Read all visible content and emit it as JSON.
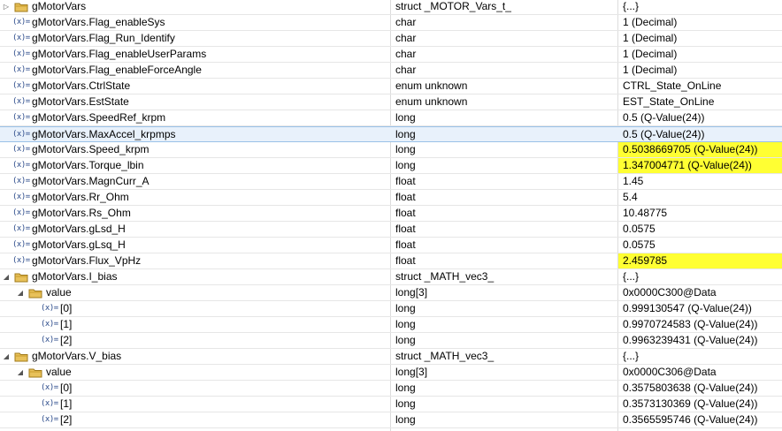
{
  "rows": [
    {
      "indent": 0,
      "expander": "collapsed",
      "icon": "folder",
      "name": "gMotorVars",
      "type": "struct _MOTOR_Vars_t_",
      "value": "{...}",
      "highlight": false
    },
    {
      "indent": 0,
      "expander": "none",
      "icon": "var",
      "name": "gMotorVars.Flag_enableSys",
      "type": "char",
      "value": "1 (Decimal)",
      "highlight": false
    },
    {
      "indent": 0,
      "expander": "none",
      "icon": "var",
      "name": "gMotorVars.Flag_Run_Identify",
      "type": "char",
      "value": "1 (Decimal)",
      "highlight": false
    },
    {
      "indent": 0,
      "expander": "none",
      "icon": "var",
      "name": "gMotorVars.Flag_enableUserParams",
      "type": "char",
      "value": "1 (Decimal)",
      "highlight": false
    },
    {
      "indent": 0,
      "expander": "none",
      "icon": "var",
      "name": "gMotorVars.Flag_enableForceAngle",
      "type": "char",
      "value": "1 (Decimal)",
      "highlight": false
    },
    {
      "indent": 0,
      "expander": "none",
      "icon": "var",
      "name": "gMotorVars.CtrlState",
      "type": "enum unknown",
      "value": "CTRL_State_OnLine",
      "highlight": false
    },
    {
      "indent": 0,
      "expander": "none",
      "icon": "var",
      "name": "gMotorVars.EstState",
      "type": "enum unknown",
      "value": "EST_State_OnLine",
      "highlight": false
    },
    {
      "indent": 0,
      "expander": "none",
      "icon": "var",
      "name": "gMotorVars.SpeedRef_krpm",
      "type": "long",
      "value": "0.5 (Q-Value(24))",
      "highlight": false
    },
    {
      "indent": 0,
      "expander": "none",
      "icon": "var",
      "name": "gMotorVars.MaxAccel_krpmps",
      "type": "long",
      "value": "0.5 (Q-Value(24))",
      "highlight": false,
      "selected": true
    },
    {
      "indent": 0,
      "expander": "none",
      "icon": "var",
      "name": "gMotorVars.Speed_krpm",
      "type": "long",
      "value": "0.5038669705 (Q-Value(24))",
      "highlight": true
    },
    {
      "indent": 0,
      "expander": "none",
      "icon": "var",
      "name": "gMotorVars.Torque_lbin",
      "type": "long",
      "value": "1.347004771 (Q-Value(24))",
      "highlight": true
    },
    {
      "indent": 0,
      "expander": "none",
      "icon": "var",
      "name": "gMotorVars.MagnCurr_A",
      "type": "float",
      "value": "1.45",
      "highlight": false
    },
    {
      "indent": 0,
      "expander": "none",
      "icon": "var",
      "name": "gMotorVars.Rr_Ohm",
      "type": "float",
      "value": "5.4",
      "highlight": false
    },
    {
      "indent": 0,
      "expander": "none",
      "icon": "var",
      "name": "gMotorVars.Rs_Ohm",
      "type": "float",
      "value": "10.48775",
      "highlight": false
    },
    {
      "indent": 0,
      "expander": "none",
      "icon": "var",
      "name": "gMotorVars.gLsd_H",
      "type": "float",
      "value": "0.0575",
      "highlight": false
    },
    {
      "indent": 0,
      "expander": "none",
      "icon": "var",
      "name": "gMotorVars.gLsq_H",
      "type": "float",
      "value": "0.0575",
      "highlight": false
    },
    {
      "indent": 0,
      "expander": "none",
      "icon": "var",
      "name": "gMotorVars.Flux_VpHz",
      "type": "float",
      "value": "2.459785",
      "highlight": true
    },
    {
      "indent": 0,
      "expander": "expanded",
      "icon": "folder",
      "name": "gMotorVars.I_bias",
      "type": "struct _MATH_vec3_",
      "value": "{...}",
      "highlight": false
    },
    {
      "indent": 1,
      "expander": "expanded",
      "icon": "folder",
      "name": "value",
      "type": "long[3]",
      "value": "0x0000C300@Data",
      "highlight": false
    },
    {
      "indent": 2,
      "expander": "none",
      "icon": "var",
      "name": "[0]",
      "type": "long",
      "value": "0.999130547 (Q-Value(24))",
      "highlight": false
    },
    {
      "indent": 2,
      "expander": "none",
      "icon": "var",
      "name": "[1]",
      "type": "long",
      "value": "0.9970724583 (Q-Value(24))",
      "highlight": false
    },
    {
      "indent": 2,
      "expander": "none",
      "icon": "var",
      "name": "[2]",
      "type": "long",
      "value": "0.9963239431 (Q-Value(24))",
      "highlight": false
    },
    {
      "indent": 0,
      "expander": "expanded",
      "icon": "folder",
      "name": "gMotorVars.V_bias",
      "type": "struct _MATH_vec3_",
      "value": "{...}",
      "highlight": false
    },
    {
      "indent": 1,
      "expander": "expanded",
      "icon": "folder",
      "name": "value",
      "type": "long[3]",
      "value": "0x0000C306@Data",
      "highlight": false
    },
    {
      "indent": 2,
      "expander": "none",
      "icon": "var",
      "name": "[0]",
      "type": "long",
      "value": "0.3575803638 (Q-Value(24))",
      "highlight": false
    },
    {
      "indent": 2,
      "expander": "none",
      "icon": "var",
      "name": "[1]",
      "type": "long",
      "value": "0.3573130369 (Q-Value(24))",
      "highlight": false
    },
    {
      "indent": 2,
      "expander": "none",
      "icon": "var",
      "name": "[2]",
      "type": "long",
      "value": "0.3565595746 (Q-Value(24))",
      "highlight": false
    }
  ],
  "var_icon_text": "(x)=",
  "colors": {
    "highlight": "#ffff33",
    "selection": "#e8f1fb",
    "folder": "#e8c15a"
  }
}
